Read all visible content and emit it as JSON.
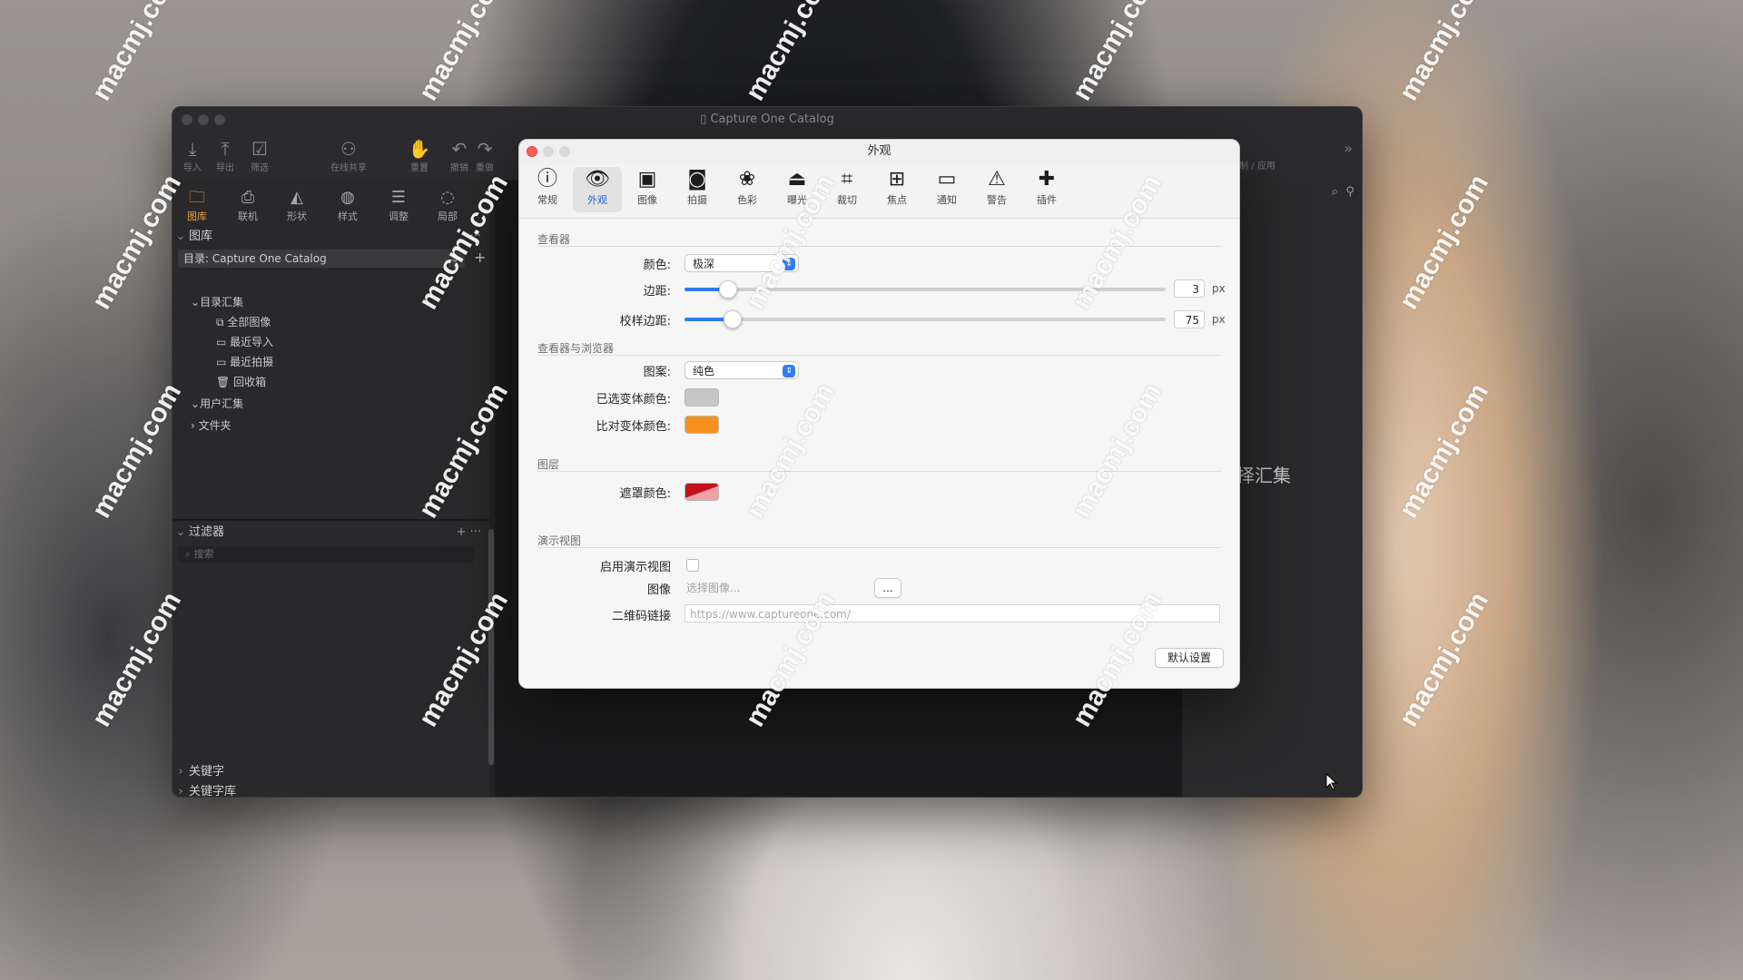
{
  "app": {
    "title": "Capture One Catalog",
    "toolbar": [
      {
        "icon": "download-icon",
        "label": "导入"
      },
      {
        "icon": "upload-icon",
        "label": "导出"
      },
      {
        "icon": "filter-check-icon",
        "label": "筛选"
      },
      {
        "icon": "people-icon",
        "label": "在线共享"
      },
      {
        "icon": "hand-icon",
        "label": "重置"
      },
      {
        "icon": "undo-icon",
        "label": "撤销"
      },
      {
        "icon": "redo-icon",
        "label": "重做"
      }
    ],
    "toolbar_right_label": "复制 / 应用",
    "tabs": [
      {
        "icon": "folder-icon",
        "label": "图库",
        "active": true
      },
      {
        "icon": "camera-tether-icon",
        "label": "联机"
      },
      {
        "icon": "lens-icon",
        "label": "形状"
      },
      {
        "icon": "style-icon",
        "label": "样式"
      },
      {
        "icon": "sliders-icon",
        "label": "调整"
      },
      {
        "icon": "circle-icon",
        "label": "局部"
      }
    ],
    "library": {
      "title": "图库",
      "catalog_selector": "目录: Capture One Catalog",
      "catalog_collections": "目录汇集",
      "items": [
        "全部图像",
        "最近导入",
        "最近拍摄",
        "回收箱"
      ],
      "user_collections": "用户汇集",
      "folders": "文件夹"
    },
    "filters": {
      "title": "过滤器",
      "search_placeholder": "搜索"
    },
    "keywords": "关键字",
    "keyword_library": "关键字库",
    "right_message": "未选择汇集"
  },
  "dialog": {
    "title": "外观",
    "tabs": [
      {
        "icon": "info-icon",
        "label": "常规"
      },
      {
        "icon": "eye-icon",
        "label": "外观",
        "active": true
      },
      {
        "icon": "image-icon",
        "label": "图像"
      },
      {
        "icon": "camera-icon",
        "label": "拍摄"
      },
      {
        "icon": "color-circles-icon",
        "label": "色彩"
      },
      {
        "icon": "exposure-icon",
        "label": "曝光"
      },
      {
        "icon": "crop-icon",
        "label": "裁切"
      },
      {
        "icon": "focus-icon",
        "label": "焦点"
      },
      {
        "icon": "message-icon",
        "label": "通知"
      },
      {
        "icon": "warning-icon",
        "label": "警告"
      },
      {
        "icon": "plugin-icon",
        "label": "插件"
      }
    ],
    "viewer": {
      "group": "查看器",
      "color_label": "颜色:",
      "color_value": "极深",
      "margin_label": "边距:",
      "margin_value": "3",
      "margin_fraction": 0.09,
      "proof_margin_label": "校样边距:",
      "proof_margin_value": "75",
      "proof_margin_fraction": 0.1,
      "unit": "px"
    },
    "viewer_browser": {
      "group": "查看器与浏览器",
      "pattern_label": "图案:",
      "pattern_value": "纯色",
      "selected_variant_label": "已选变体颜色:",
      "selected_variant_color": "#c6c6c6",
      "compare_variant_label": "比对变体颜色:",
      "compare_variant_color": "#f5921f"
    },
    "layers": {
      "group": "图层",
      "mask_color_label": "遮罩颜色:"
    },
    "presentation": {
      "group": "演示视图",
      "enable_label": "启用演示视图",
      "image_label": "图像",
      "image_placeholder": "选择图像...",
      "browse_button": "...",
      "qr_label": "二维码链接",
      "qr_placeholder": "https://www.captureone.com/"
    },
    "defaults_button": "默认设置"
  },
  "watermark": "macmj.com"
}
